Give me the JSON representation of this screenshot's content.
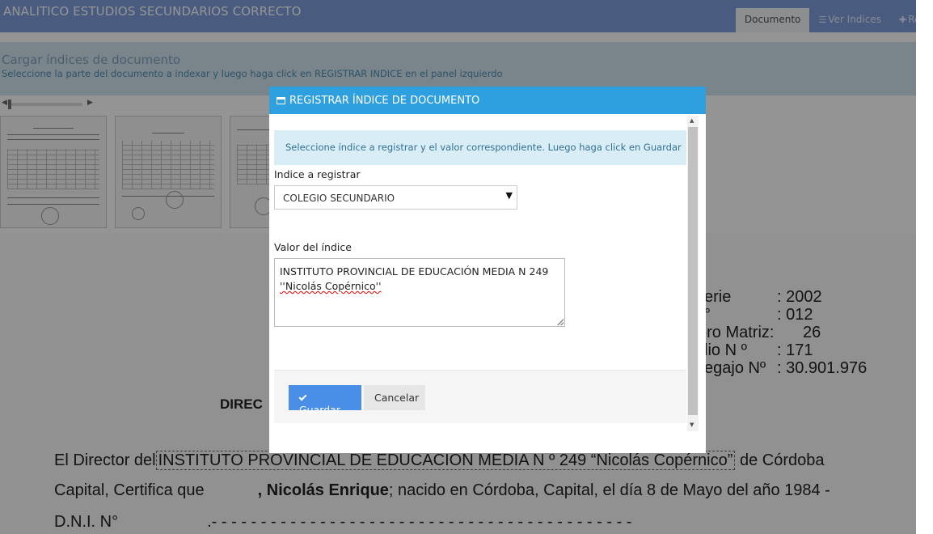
{
  "app": {
    "title": "ANALITICO ESTUDIOS SECUNDARIOS CORRECTO"
  },
  "tabs": [
    {
      "label": "Documento",
      "icon": "",
      "active": true
    },
    {
      "label": "Ver Indices",
      "icon": "list-icon",
      "active": false
    },
    {
      "label": "Reg",
      "icon": "plus-icon",
      "active": false
    }
  ],
  "banner": {
    "title": "Cargar índices de documento",
    "subtitle": "Seleccione la parte del documento a indexar y luego haga click en REGISTRAR INDICE en el panel izquierdo"
  },
  "document": {
    "heading_fragment": "DIREC",
    "meta_lines": [
      {
        "label": "erie",
        "value": ": 2002"
      },
      {
        "label": "°",
        "value": ":  012"
      },
      {
        "label": "bro Matriz:",
        "value": "26"
      },
      {
        "label": "lio N º",
        "value": ":   171"
      },
      {
        "label": "egajo Nº",
        "value": ":  30.901.976"
      }
    ],
    "body_line1_pre": "El Director del",
    "body_line1_selection": "INSTITUTO PROVINCIAL DE EDUCACION MEDIA N º 249 “Nicolás Copérnico”",
    "body_line1_post": "de  Córdoba",
    "body_line2_pre": "Capital, Certifica que",
    "body_line2_bold": ", Nicolás Enrique",
    "body_line2_post": "; nacido en Córdoba, Capital, el día 8 de Mayo del año 1984 -",
    "body_line3_pre": "D.N.I. N°",
    "body_line3_post": ".- - - - - - - - - - - - - - - - - - - - - - - - - - - - - - - - - - - - - - - - - - -"
  },
  "modal": {
    "title": "REGISTRAR ÍNDICE DE DOCUMENTO",
    "info": "Seleccione índice a registrar y el valor correspondiente. Luego haga click en Guardar",
    "index_label": "Indice a registrar",
    "index_selected": "COLEGIO SECUNDARIO",
    "value_label": "Valor del índice",
    "value_line1": "INSTITUTO PROVINCIAL DE EDUCACIÓN MEDIA N 249",
    "value_line2": "''Nicolás Copérnico''",
    "save_label": "Guardar",
    "cancel_label": "Cancelar"
  },
  "colors": {
    "topbar": "#7e9fdb",
    "modal_header": "#2ea0e0",
    "save_button": "#4a8fe7",
    "info_bg": "#d9edf7"
  }
}
